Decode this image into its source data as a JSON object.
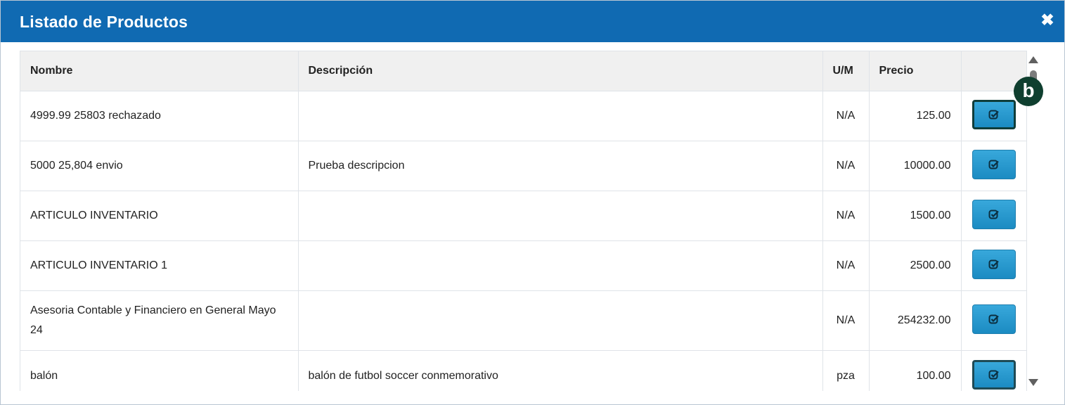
{
  "dialog": {
    "title": "Listado de Productos",
    "close_glyph": "✖"
  },
  "table": {
    "headers": {
      "name": "Nombre",
      "description": "Descripción",
      "um": "U/M",
      "price": "Precio",
      "action": ""
    },
    "rows": [
      {
        "name": "4999.99 25803 rechazado",
        "description": "",
        "um": "N/A",
        "price": "125.00"
      },
      {
        "name": "5000 25,804 envio",
        "description": "Prueba descripcion",
        "um": "N/A",
        "price": "10000.00"
      },
      {
        "name": "ARTICULO INVENTARIO",
        "description": "",
        "um": "N/A",
        "price": "1500.00"
      },
      {
        "name": "ARTICULO INVENTARIO 1",
        "description": "",
        "um": "N/A",
        "price": "2500.00"
      },
      {
        "name": "Asesoria Contable y Financiero en General Mayo 24",
        "description": "",
        "um": "N/A",
        "price": "254232.00"
      },
      {
        "name": "balón",
        "description": "balón de futbol soccer conmemorativo",
        "um": "pza",
        "price": "100.00"
      }
    ]
  },
  "overlay": {
    "badge_label": "b"
  },
  "icons": {
    "close": "close-icon",
    "select": "check-square-icon",
    "scroll_up": "scroll-up-arrow-icon",
    "scroll_down": "scroll-down-arrow-icon"
  },
  "colors": {
    "titlebar": "#106ab2",
    "button": "#2a9bd0",
    "badge": "#0f3f2f",
    "header_bg": "#f0f0f0"
  }
}
